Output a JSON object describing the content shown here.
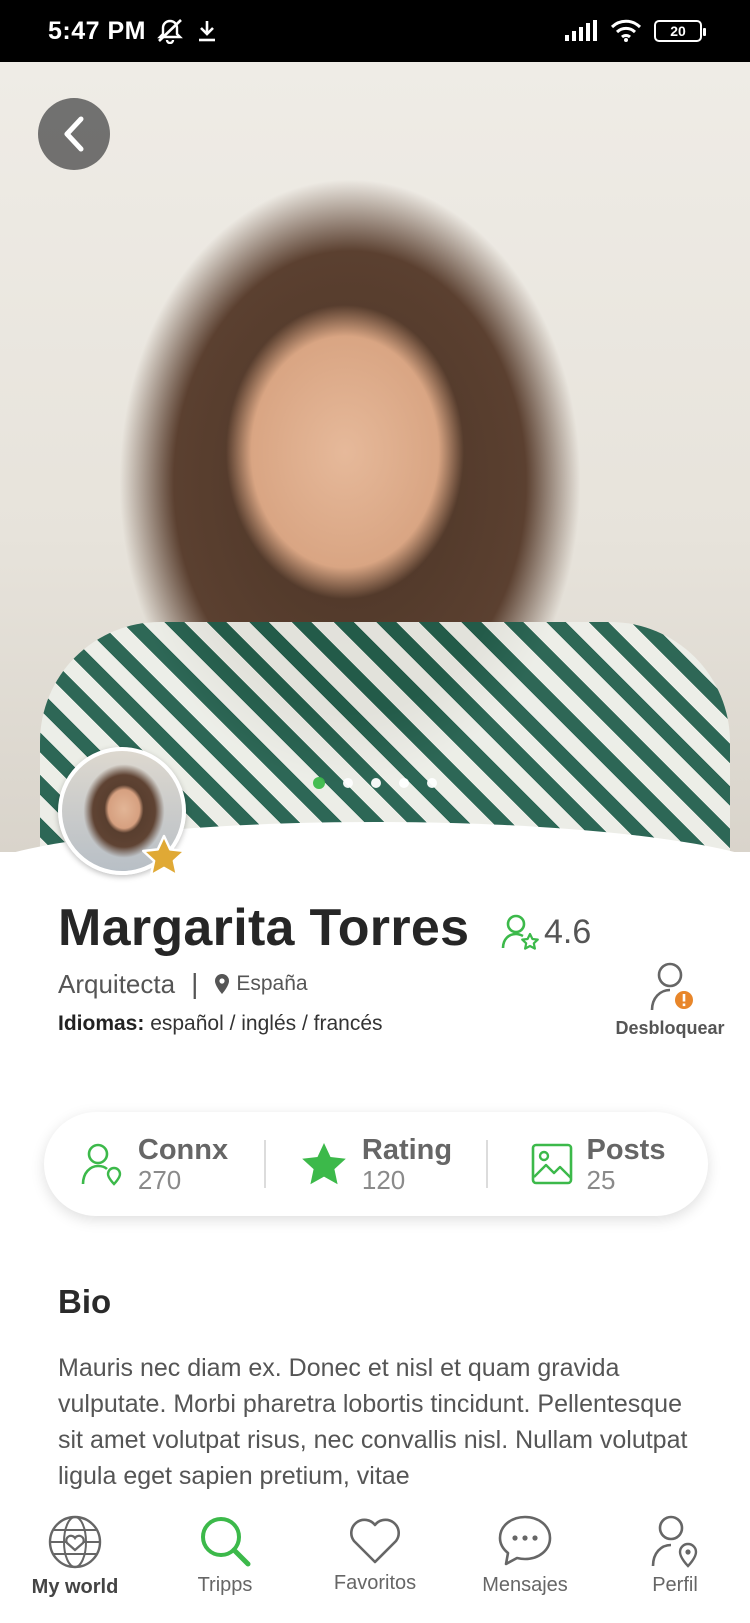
{
  "status_bar": {
    "time": "5:47 PM",
    "battery": "20"
  },
  "profile": {
    "name": "Margarita Torres",
    "rating": "4.6",
    "profession": "Arquitecta",
    "separator": "|",
    "location": "España",
    "languages_label": "Idiomas:",
    "languages_value": "español / inglés / francés",
    "unblock_label": "Desbloquear"
  },
  "carousel": {
    "count": 5,
    "active_index": 0
  },
  "stats": [
    {
      "label": "Connx",
      "value": "270",
      "icon": "connections-icon"
    },
    {
      "label": "Rating",
      "value": "120",
      "icon": "star-icon"
    },
    {
      "label": "Posts",
      "value": "25",
      "icon": "image-icon"
    }
  ],
  "bio": {
    "title": "Bio",
    "text": "Mauris nec diam ex. Donec et nisl et quam gravida vulputate. Morbi pharetra lobortis tincidunt. Pellentesque sit amet volutpat risus, nec convallis nisl. Nullam volutpat ligula eget sapien pretium, vitae"
  },
  "nav": [
    {
      "label": "My world",
      "icon": "globe-heart-icon",
      "active": true
    },
    {
      "label": "Tripps",
      "icon": "search-icon"
    },
    {
      "label": "Favoritos",
      "icon": "heart-icon"
    },
    {
      "label": "Mensajes",
      "icon": "chat-icon"
    },
    {
      "label": "Perfil",
      "icon": "user-location-icon"
    }
  ],
  "colors": {
    "accent": "#3cb94a",
    "badge": "#e0a935",
    "alert": "#e8862a"
  }
}
